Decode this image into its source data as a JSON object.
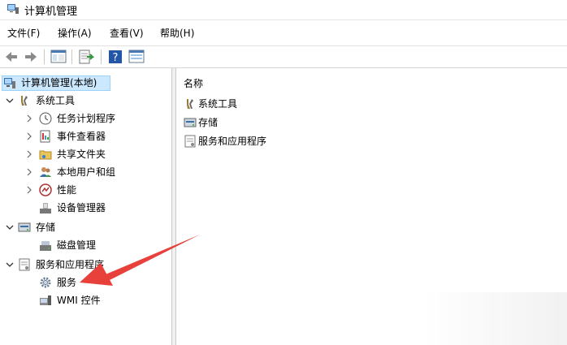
{
  "window": {
    "title": "计算机管理"
  },
  "menu": [
    {
      "label": "文件(F)"
    },
    {
      "label": "操作(A)"
    },
    {
      "label": "查看(V)"
    },
    {
      "label": "帮助(H)"
    }
  ],
  "toolbar": {
    "buttons": [
      "back-icon",
      "forward-icon",
      "show-hide-tree-icon",
      "export-list-icon",
      "help-icon",
      "properties-icon"
    ]
  },
  "tree": {
    "root": "计算机管理(本地)",
    "system_tools": "系统工具",
    "task_scheduler": "任务计划程序",
    "event_viewer": "事件查看器",
    "shared_folders": "共享文件夹",
    "local_users": "本地用户和组",
    "performance": "性能",
    "device_manager": "设备管理器",
    "storage": "存储",
    "disk_management": "磁盘管理",
    "services_apps": "服务和应用程序",
    "services": "服务",
    "wmi": "WMI 控件"
  },
  "list": {
    "column_header": "名称",
    "items": [
      "系统工具",
      "存储",
      "服务和应用程序"
    ]
  },
  "colors": {
    "selection": "#cce8ff",
    "annotation_arrow": "#e8413c"
  }
}
